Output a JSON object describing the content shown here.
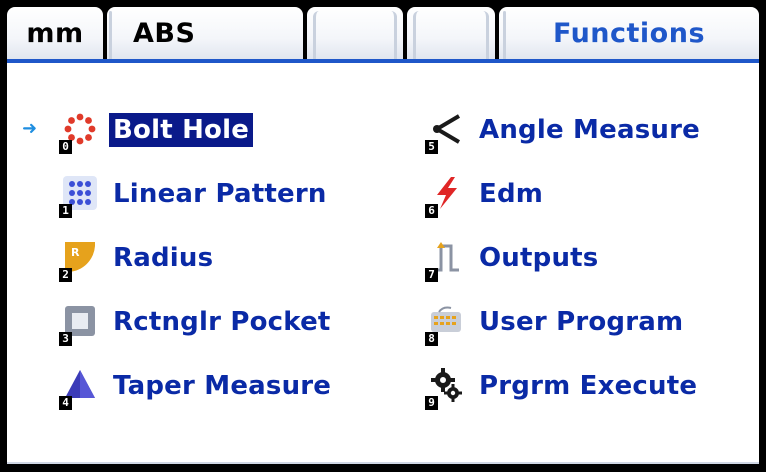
{
  "tabs": {
    "units": "mm",
    "mode": "ABS",
    "blank1": "",
    "blank2": "",
    "functions": "Functions"
  },
  "menu": {
    "items": [
      {
        "num": "0",
        "label": "Bolt Hole",
        "icon": "bolt-hole-icon"
      },
      {
        "num": "1",
        "label": "Linear Pattern",
        "icon": "linear-pattern-icon"
      },
      {
        "num": "2",
        "label": "Radius",
        "icon": "radius-icon"
      },
      {
        "num": "3",
        "label": "Rctnglr Pocket",
        "icon": "rectangular-pocket-icon"
      },
      {
        "num": "4",
        "label": "Taper Measure",
        "icon": "taper-measure-icon"
      },
      {
        "num": "5",
        "label": "Angle Measure",
        "icon": "angle-measure-icon"
      },
      {
        "num": "6",
        "label": "Edm",
        "icon": "edm-icon"
      },
      {
        "num": "7",
        "label": "Outputs",
        "icon": "outputs-icon"
      },
      {
        "num": "8",
        "label": "User Program",
        "icon": "user-program-icon"
      },
      {
        "num": "9",
        "label": "Prgrm Execute",
        "icon": "program-execute-icon"
      }
    ],
    "selected_index": 0,
    "pointer": "➜"
  },
  "colors": {
    "accent": "#1f57c9",
    "label": "#0a2aa6",
    "selected_bg": "#0a1a8a"
  }
}
